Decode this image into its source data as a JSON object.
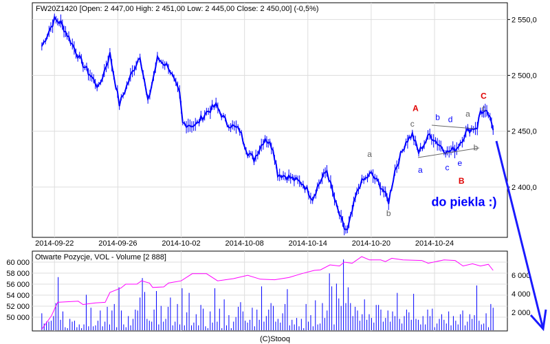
{
  "chart_data": [
    {
      "type": "line",
      "title": "FW20Z1420 [Open: 2 447,00  High: 2 451,00  Low: 2 445,00  Close: 2 450,00] (-0,5%)",
      "ylim": [
        2355,
        2565
      ],
      "y_ticks": [
        {
          "v": 2400,
          "label": "2 400,0"
        },
        {
          "v": 2450,
          "label": "2 450,0"
        },
        {
          "v": 2500,
          "label": "2 500,0"
        },
        {
          "v": 2550,
          "label": "2 550,0"
        }
      ],
      "x_ticks": [
        {
          "t": 0,
          "label": "2014-09-22"
        },
        {
          "t": 4,
          "label": "2014-09-26"
        },
        {
          "t": 8,
          "label": "2014-10-02"
        },
        {
          "t": 12,
          "label": "2014-10-08"
        },
        {
          "t": 16,
          "label": "2014-10-14"
        },
        {
          "t": 20,
          "label": "2014-10-20"
        },
        {
          "t": 24,
          "label": "2014-10-24"
        }
      ],
      "xlim": [
        -1.4,
        28.6
      ],
      "grid": true,
      "series": [
        {
          "name": "FW20Z1420",
          "color": "#0000ff",
          "points": [
            [
              -0.8,
              2526
            ],
            [
              0,
              2550
            ],
            [
              0.4,
              2547
            ],
            [
              0.9,
              2534
            ],
            [
              1.7,
              2512
            ],
            [
              2.8,
              2489
            ],
            [
              3.5,
              2519
            ],
            [
              4.1,
              2474
            ],
            [
              4.8,
              2499
            ],
            [
              5.4,
              2518
            ],
            [
              5.9,
              2476
            ],
            [
              6.5,
              2515
            ],
            [
              7.2,
              2508
            ],
            [
              7.9,
              2483
            ],
            [
              8.1,
              2457
            ],
            [
              8.9,
              2455
            ],
            [
              9.6,
              2467
            ],
            [
              10.2,
              2473
            ],
            [
              10.9,
              2457
            ],
            [
              11.7,
              2451
            ],
            [
              12.2,
              2431
            ],
            [
              12.6,
              2425
            ],
            [
              13.3,
              2444
            ],
            [
              13.8,
              2435
            ],
            [
              14.1,
              2412
            ],
            [
              14.8,
              2409
            ],
            [
              15.7,
              2403
            ],
            [
              16.3,
              2390
            ],
            [
              16.7,
              2403
            ],
            [
              17.2,
              2415
            ],
            [
              17.8,
              2383
            ],
            [
              18.3,
              2363
            ],
            [
              18.5,
              2361
            ],
            [
              19.0,
              2390
            ],
            [
              19.3,
              2403
            ],
            [
              20.0,
              2412
            ],
            [
              20.7,
              2399
            ],
            [
              21.1,
              2387
            ],
            [
              21.5,
              2415
            ],
            [
              22.2,
              2441
            ],
            [
              22.6,
              2447
            ],
            [
              23.0,
              2431
            ],
            [
              23.7,
              2447
            ],
            [
              24.3,
              2438
            ],
            [
              24.8,
              2431
            ],
            [
              25.4,
              2435
            ],
            [
              26.1,
              2451
            ],
            [
              26.7,
              2454
            ],
            [
              26.9,
              2468
            ],
            [
              27.4,
              2465
            ],
            [
              27.7,
              2451
            ]
          ]
        }
      ],
      "annotations": [
        {
          "text": "A",
          "color": "#e00000",
          "t": 22.8,
          "v": 2468
        },
        {
          "text": "B",
          "color": "#e00000",
          "t": 25.7,
          "v": 2403
        },
        {
          "text": "C",
          "color": "#e00000",
          "t": 27.1,
          "v": 2479
        },
        {
          "text": "c",
          "color": "#606060",
          "t": 22.6,
          "v": 2454
        },
        {
          "text": "a",
          "color": "#606060",
          "t": 19.9,
          "v": 2427
        },
        {
          "text": "b",
          "color": "#606060",
          "t": 21.1,
          "v": 2374
        },
        {
          "text": "a",
          "color": "#606060",
          "t": 26.1,
          "v": 2463
        },
        {
          "text": "c",
          "color": "#606060",
          "t": 27.1,
          "v": 2468
        },
        {
          "text": "b",
          "color": "#606060",
          "t": 26.6,
          "v": 2433
        },
        {
          "text": "a",
          "color": "#0000ff",
          "t": 23.1,
          "v": 2413
        },
        {
          "text": "b",
          "color": "#0000ff",
          "t": 24.2,
          "v": 2460
        },
        {
          "text": "d",
          "color": "#0000ff",
          "t": 25.0,
          "v": 2458
        },
        {
          "text": "c",
          "color": "#0000ff",
          "t": 24.8,
          "v": 2415
        },
        {
          "text": "e",
          "color": "#0000ff",
          "t": 25.6,
          "v": 2419
        },
        {
          "text": "do piekla :)",
          "color": "#0000ff",
          "t": 23.8,
          "v": 2383
        }
      ]
    },
    {
      "type": "bar",
      "title": "Otwarte Pozycje, VOL - Volume [2 888]",
      "left_axis": {
        "name": "Otwarte Pozycje",
        "ylim": [
          47500,
          62000
        ],
        "ticks": [
          {
            "v": 50000,
            "label": "50 000"
          },
          {
            "v": 52000,
            "label": "52 000"
          },
          {
            "v": 54000,
            "label": "54 000"
          },
          {
            "v": 56000,
            "label": "56 000"
          },
          {
            "v": 58000,
            "label": "58 000"
          },
          {
            "v": 60000,
            "label": "60 000"
          }
        ]
      },
      "right_axis": {
        "name": "Volume",
        "ylim": [
          0,
          8600
        ],
        "ticks": [
          {
            "v": 2000,
            "label": "2 000"
          },
          {
            "v": 4000,
            "label": "4 000"
          },
          {
            "v": 6000,
            "label": "6 000"
          }
        ]
      },
      "open_interest": {
        "color": "#ff00ff",
        "points": [
          [
            -0.8,
            47800
          ],
          [
            -0.2,
            50200
          ],
          [
            0.2,
            52700
          ],
          [
            1.5,
            52900
          ],
          [
            1.8,
            52300
          ],
          [
            2.6,
            52600
          ],
          [
            3.2,
            52700
          ],
          [
            3.5,
            54500
          ],
          [
            4.2,
            55300
          ],
          [
            4.5,
            56000
          ],
          [
            5.2,
            56000
          ],
          [
            5.5,
            56600
          ],
          [
            6.0,
            56200
          ],
          [
            6.2,
            55400
          ],
          [
            6.9,
            55500
          ],
          [
            7.2,
            56200
          ],
          [
            8.0,
            56600
          ],
          [
            8.7,
            57900
          ],
          [
            9.6,
            57900
          ],
          [
            10.3,
            56600
          ],
          [
            11.3,
            57000
          ],
          [
            12.2,
            57600
          ],
          [
            13.0,
            56900
          ],
          [
            13.9,
            56800
          ],
          [
            14.8,
            57200
          ],
          [
            15.6,
            57900
          ],
          [
            16.4,
            58500
          ],
          [
            16.8,
            58600
          ],
          [
            17.4,
            59500
          ],
          [
            18.0,
            59300
          ],
          [
            18.3,
            60000
          ],
          [
            18.8,
            59800
          ],
          [
            19.4,
            61000
          ],
          [
            19.9,
            60400
          ],
          [
            20.6,
            60400
          ],
          [
            20.9,
            60100
          ],
          [
            21.3,
            60700
          ],
          [
            22.0,
            60400
          ],
          [
            23.2,
            60300
          ],
          [
            23.6,
            59800
          ],
          [
            24.6,
            60400
          ],
          [
            25.3,
            60300
          ],
          [
            25.8,
            59300
          ],
          [
            26.4,
            59700
          ],
          [
            26.9,
            59300
          ],
          [
            27.4,
            59600
          ],
          [
            27.7,
            58500
          ]
        ]
      },
      "volume": {
        "color": "#0000ff",
        "values": [
          1900,
          800,
          1000,
          1000,
          1100,
          1600,
          3000,
          5800,
          1200,
          2100,
          400,
          300,
          1300,
          1000,
          1100,
          400,
          700,
          300,
          700,
          3900,
          500,
          2500,
          500,
          600,
          1100,
          2200,
          500,
          1000,
          2600,
          700,
          2200,
          2900,
          400,
          4700,
          2200,
          700,
          400,
          1600,
          600,
          1300,
          2300,
          2200,
          3600,
          5700,
          4200,
          1300,
          1100,
          1000,
          2300,
          4300,
          700,
          2700,
          1000,
          1300,
          2600,
          3600,
          600,
          1000,
          2900,
          700,
          4600,
          600,
          2000,
          4100,
          600,
          900,
          1800,
          600,
          2800,
          2400,
          500,
          300,
          2100,
          900,
          4600,
          1000,
          2400,
          300,
          3400,
          600,
          1700,
          300,
          1000,
          1500,
          2600,
          3100,
          2100,
          1100,
          900,
          1200,
          2500,
          500,
          2300,
          1200,
          4800,
          1000,
          1600,
          2300,
          3000,
          2700,
          1000,
          1300,
          900,
          1900,
          2900,
          4500,
          600,
          1200,
          700,
          1400,
          500,
          1300,
          300,
          2900,
          1000,
          1700,
          500,
          3300,
          700,
          800,
          3000,
          1400,
          2200,
          6200,
          4800,
          700,
          5100,
          3500,
          2700,
          7700,
          3000,
          4700,
          3000,
          1600,
          2600,
          2200,
          1100,
          1800,
          3400,
          1200,
          1800,
          1400,
          900,
          2800,
          2800,
          2300,
          1000,
          1400,
          2200,
          1000,
          2100,
          1600,
          4100,
          1300,
          800,
          1600,
          2300,
          2000,
          1200,
          4000,
          1300,
          1200,
          700,
          1600,
          700,
          2300,
          1600,
          2400,
          400,
          800,
          1300,
          1800,
          1200,
          800,
          2100,
          600,
          1600,
          1100,
          700,
          1800,
          2200,
          600,
          1000,
          1800,
          1300,
          1700,
          4900,
          1100,
          700,
          800,
          1900,
          400,
          2900,
          2500
        ]
      }
    }
  ],
  "footer": "(C)Stooq"
}
